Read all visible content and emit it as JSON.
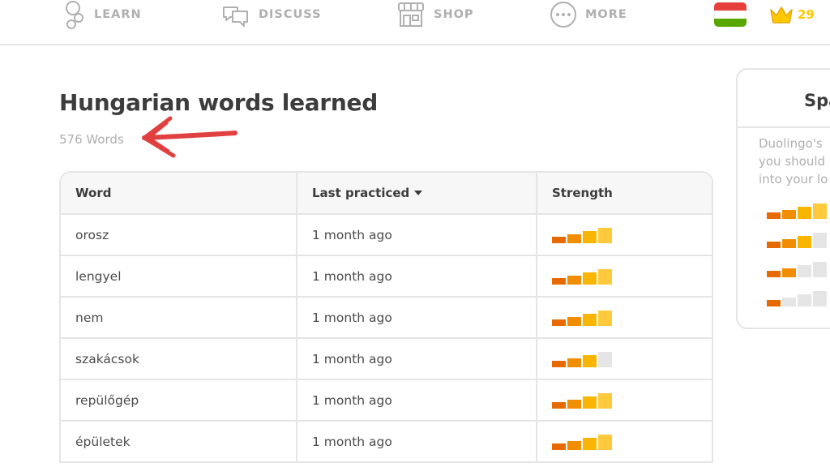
{
  "nav": {
    "items": [
      {
        "label": "LEARN",
        "icon": "learn-icon"
      },
      {
        "label": "DISCUSS",
        "icon": "discuss-icon"
      },
      {
        "label": "SHOP",
        "icon": "shop-icon"
      },
      {
        "label": "MORE",
        "icon": "more-icon"
      }
    ],
    "crown_count": "29"
  },
  "page": {
    "title": "Hungarian words learned",
    "word_count": "576 Words"
  },
  "table": {
    "headers": {
      "word": "Word",
      "last_practiced": "Last practiced",
      "strength": "Strength"
    },
    "rows": [
      {
        "word": "orosz",
        "last_practiced": "1 month ago",
        "strength": 4
      },
      {
        "word": "lengyel",
        "last_practiced": "1 month ago",
        "strength": 4
      },
      {
        "word": "nem",
        "last_practiced": "1 month ago",
        "strength": 4
      },
      {
        "word": "szakácsok",
        "last_practiced": "1 month ago",
        "strength": 3
      },
      {
        "word": "repülőgép",
        "last_practiced": "1 month ago",
        "strength": 4
      },
      {
        "word": "épületek",
        "last_practiced": "1 month ago",
        "strength": 4
      }
    ]
  },
  "side_card": {
    "title": "Spa",
    "text_lines": [
      "Duolingo's",
      "you should",
      "into your lo"
    ],
    "legend_levels": [
      4,
      3,
      2,
      1
    ]
  },
  "colors": {
    "strength_filled": [
      "#e76a00",
      "#f08e00",
      "#f9b500",
      "#ffc93c"
    ],
    "strength_empty": "#e5e5e5",
    "nav_gray": "#afafaf",
    "crown": "#ffc800",
    "flag": [
      "#e5403b",
      "#ffffff",
      "#58a700"
    ],
    "annotation": "#e0403f"
  }
}
